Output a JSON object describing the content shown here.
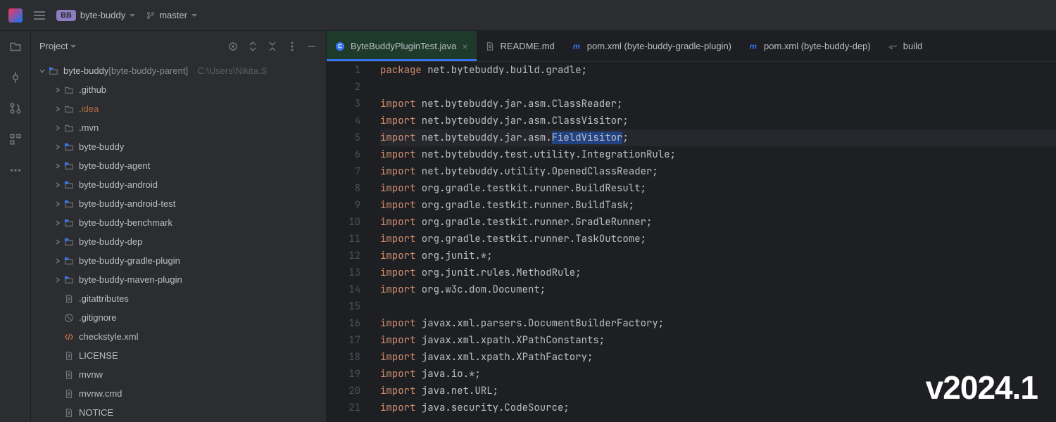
{
  "titlebar": {
    "project_badge": "BB",
    "project_name": "byte-buddy",
    "branch": "master"
  },
  "sidebar_rail": {
    "items": [
      "folder",
      "commit",
      "pull-request",
      "structure",
      "more"
    ]
  },
  "project_panel": {
    "title": "Project",
    "tree": {
      "root_name": "byte-buddy",
      "root_qualified": "[byte-buddy-parent]",
      "root_path": "C:\\Users\\Nikita.S",
      "children": [
        {
          "name": ".github",
          "type": "folder",
          "expandable": true
        },
        {
          "name": ".idea",
          "type": "folder",
          "expandable": true,
          "highlight": true
        },
        {
          "name": ".mvn",
          "type": "folder",
          "expandable": true
        },
        {
          "name": "byte-buddy",
          "type": "module",
          "expandable": true
        },
        {
          "name": "byte-buddy-agent",
          "type": "module",
          "expandable": true
        },
        {
          "name": "byte-buddy-android",
          "type": "module",
          "expandable": true
        },
        {
          "name": "byte-buddy-android-test",
          "type": "module",
          "expandable": true
        },
        {
          "name": "byte-buddy-benchmark",
          "type": "module",
          "expandable": true
        },
        {
          "name": "byte-buddy-dep",
          "type": "module",
          "expandable": true
        },
        {
          "name": "byte-buddy-gradle-plugin",
          "type": "module",
          "expandable": true
        },
        {
          "name": "byte-buddy-maven-plugin",
          "type": "module",
          "expandable": true
        },
        {
          "name": ".gitattributes",
          "type": "textfile"
        },
        {
          "name": ".gitignore",
          "type": "ignore"
        },
        {
          "name": "checkstyle.xml",
          "type": "xml"
        },
        {
          "name": "LICENSE",
          "type": "textfile"
        },
        {
          "name": "mvnw",
          "type": "textfile"
        },
        {
          "name": "mvnw.cmd",
          "type": "textfile"
        },
        {
          "name": "NOTICE",
          "type": "textfile"
        }
      ]
    }
  },
  "tabs": [
    {
      "label": "ByteBuddyPluginTest.java",
      "icon": "class",
      "active": true,
      "closeable": true
    },
    {
      "label": "README.md",
      "icon": "md"
    },
    {
      "label": "pom.xml (byte-buddy-gradle-plugin)",
      "icon": "maven"
    },
    {
      "label": "pom.xml (byte-buddy-dep)",
      "icon": "maven"
    },
    {
      "label": "build",
      "icon": "gradle",
      "partial": true
    }
  ],
  "editor": {
    "highlighted_line": 5,
    "lines": [
      {
        "n": 1,
        "t": [
          [
            "kw",
            "package"
          ],
          [
            "pkg",
            " net.bytebuddy.build.gradle;"
          ]
        ]
      },
      {
        "n": 2,
        "t": []
      },
      {
        "n": 3,
        "t": [
          [
            "kw",
            "import"
          ],
          [
            "pkg",
            " net.bytebuddy.jar.asm.ClassReader;"
          ]
        ]
      },
      {
        "n": 4,
        "t": [
          [
            "kw",
            "import"
          ],
          [
            "pkg",
            " net.bytebuddy.jar.asm.ClassVisitor;"
          ]
        ]
      },
      {
        "n": 5,
        "t": [
          [
            "kw",
            "import"
          ],
          [
            "pkg",
            " net.bytebuddy.jar.asm."
          ],
          [
            "sel",
            "FieldVisitor"
          ],
          [
            "pkg",
            ";"
          ]
        ]
      },
      {
        "n": 6,
        "t": [
          [
            "kw",
            "import"
          ],
          [
            "pkg",
            " net.bytebuddy.test.utility.IntegrationRule;"
          ]
        ]
      },
      {
        "n": 7,
        "t": [
          [
            "kw",
            "import"
          ],
          [
            "pkg",
            " net.bytebuddy.utility.OpenedClassReader;"
          ]
        ]
      },
      {
        "n": 8,
        "t": [
          [
            "kw",
            "import"
          ],
          [
            "pkg",
            " org.gradle.testkit.runner.BuildResult;"
          ]
        ]
      },
      {
        "n": 9,
        "t": [
          [
            "kw",
            "import"
          ],
          [
            "pkg",
            " org.gradle.testkit.runner.BuildTask;"
          ]
        ]
      },
      {
        "n": 10,
        "t": [
          [
            "kw",
            "import"
          ],
          [
            "pkg",
            " org.gradle.testkit.runner.GradleRunner;"
          ]
        ]
      },
      {
        "n": 11,
        "t": [
          [
            "kw",
            "import"
          ],
          [
            "pkg",
            " org.gradle.testkit.runner.TaskOutcome;"
          ]
        ]
      },
      {
        "n": 12,
        "t": [
          [
            "kw",
            "import"
          ],
          [
            "pkg",
            " org.junit.*;"
          ]
        ]
      },
      {
        "n": 13,
        "t": [
          [
            "kw",
            "import"
          ],
          [
            "pkg",
            " org.junit.rules.MethodRule;"
          ]
        ]
      },
      {
        "n": 14,
        "t": [
          [
            "kw",
            "import"
          ],
          [
            "pkg",
            " org.w3c.dom.Document;"
          ]
        ]
      },
      {
        "n": 15,
        "t": []
      },
      {
        "n": 16,
        "t": [
          [
            "kw",
            "import"
          ],
          [
            "pkg",
            " javax.xml.parsers.DocumentBuilderFactory;"
          ]
        ]
      },
      {
        "n": 17,
        "t": [
          [
            "kw",
            "import"
          ],
          [
            "pkg",
            " javax.xml.xpath.XPathConstants;"
          ]
        ]
      },
      {
        "n": 18,
        "t": [
          [
            "kw",
            "import"
          ],
          [
            "pkg",
            " javax.xml.xpath.XPathFactory;"
          ]
        ]
      },
      {
        "n": 19,
        "t": [
          [
            "kw",
            "import"
          ],
          [
            "pkg",
            " java.io.*;"
          ]
        ]
      },
      {
        "n": 20,
        "t": [
          [
            "kw",
            "import"
          ],
          [
            "pkg",
            " java.net.URL;"
          ]
        ]
      },
      {
        "n": 21,
        "t": [
          [
            "kw",
            "import"
          ],
          [
            "pkg",
            " java.security.CodeSource;"
          ]
        ]
      }
    ]
  },
  "watermark": "v2024.1"
}
